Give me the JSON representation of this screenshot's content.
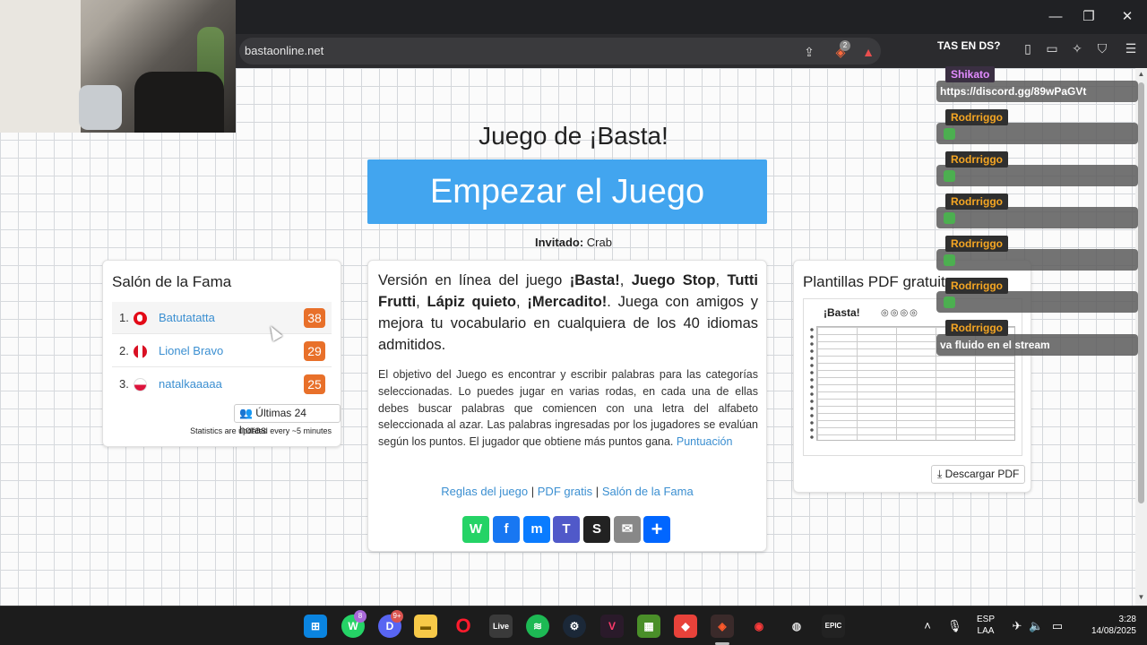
{
  "browser": {
    "url": "bastaonline.net",
    "shield_count": "2",
    "window_controls": {
      "minimize": "—",
      "maximize": "❐",
      "close": "✕"
    }
  },
  "page": {
    "title": "Juego de ¡Basta!",
    "start_button": "Empezar el Juego",
    "guest_label": "Invitado:",
    "guest_name": "Crab"
  },
  "fame": {
    "title": "Salón de la Fama",
    "rows": [
      {
        "rank": "1.",
        "name": "Batutatatta",
        "score": "38"
      },
      {
        "rank": "2.",
        "name": "Lionel Bravo",
        "score": "29"
      },
      {
        "rank": "3.",
        "name": "natalkaaaaa",
        "score": "25"
      }
    ],
    "period_button": "Últimas 24 horas",
    "stats_note": "Statistics are updated every ~5 minutes"
  },
  "main": {
    "lead_1": "Versión en línea del juego ",
    "lead_b1": "¡Basta!",
    "lead_c1": ", ",
    "lead_b2": "Juego Stop",
    "lead_c2": ", ",
    "lead_b3": "Tutti Frutti",
    "lead_c3": ", ",
    "lead_b4": "Lápiz quieto",
    "lead_c4": ", ",
    "lead_b5": "¡Mercadito!",
    "lead_2": ". Juega con amigos y mejora tu vocabulario en cualquiera de los 40 idiomas admitidos.",
    "body": "El objetivo del Juego es encontrar y escribir palabras para las categorías seleccionadas. Lo puedes jugar en varias rodas, en cada una de ellas debes buscar palabras que comiencen con una letra del alfabeto seleccionada al azar. Las palabras ingresadas por los jugadores se evalúan según los puntos. El jugador que obtiene más puntos gana.",
    "score_link": "Puntuación",
    "links": [
      "Reglas del juego",
      "PDF gratis",
      "Salón de la Fama"
    ],
    "separator": "|",
    "share": [
      {
        "label": "W",
        "name": "whatsapp",
        "color": "#25d366"
      },
      {
        "label": "f",
        "name": "facebook",
        "color": "#1877f2"
      },
      {
        "label": "m",
        "name": "messenger",
        "color": "#0a7cff"
      },
      {
        "label": "T",
        "name": "teams",
        "color": "#5059c9"
      },
      {
        "label": "S",
        "name": "snapchat",
        "color": "#222222"
      },
      {
        "label": "✉",
        "name": "email",
        "color": "#888888"
      },
      {
        "label": "+",
        "name": "share",
        "color": "#0166ff"
      }
    ]
  },
  "pdf": {
    "title": "Plantillas PDF gratuit",
    "thumb_title": "¡Basta!",
    "download_button": "Descargar PDF"
  },
  "chat": {
    "header": "TAS EN DS?",
    "messages": [
      {
        "user": "Shikato",
        "text": "https://discord.gg/89wPaGVt",
        "emote": false
      },
      {
        "user": "Rodrriggo",
        "text": "",
        "emote": true
      },
      {
        "user": "Rodrriggo",
        "text": "",
        "emote": true
      },
      {
        "user": "Rodrriggo",
        "text": "",
        "emote": true
      },
      {
        "user": "Rodrriggo",
        "text": "",
        "emote": true
      },
      {
        "user": "Rodrriggo",
        "text": "",
        "emote": true
      },
      {
        "user": "Rodrriggo",
        "text": "va fluido en el stream",
        "emote": false
      }
    ]
  },
  "taskbar": {
    "whatsapp_badge": "8",
    "discord_badge": "9+",
    "live_label": "Live",
    "epic_label": "EPIC",
    "lang_top": "ESP",
    "lang_bottom": "LAA",
    "time": "3:28",
    "date": "14/08/2025"
  }
}
